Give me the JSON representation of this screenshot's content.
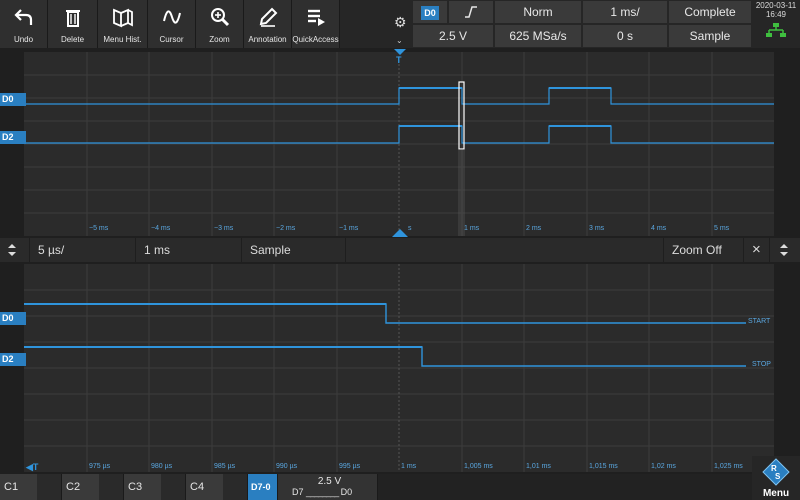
{
  "toolbar": {
    "buttons": [
      {
        "label": "Undo",
        "icon": "undo-icon"
      },
      {
        "label": "Delete",
        "icon": "trash-icon"
      },
      {
        "label": "Menu Hist.",
        "icon": "menu-history-icon"
      },
      {
        "label": "Cursor",
        "icon": "cursor-wave-icon"
      },
      {
        "label": "Zoom",
        "icon": "zoom-icon"
      },
      {
        "label": "Annotation",
        "icon": "pencil-icon"
      },
      {
        "label": "QuickAccess",
        "icon": "quick-access-icon"
      }
    ]
  },
  "settings": {
    "trigger_source": "D0",
    "trigger_edge_icon": "rising-edge-icon",
    "trigger_mode": "Norm",
    "time_scale": "1 ms/",
    "acq_status": "Complete",
    "threshold": "2.5 V",
    "sample_rate": "625 MSa/s",
    "time_offset": "0 s",
    "acq_mode": "Sample",
    "date": "2020-03-11",
    "time": "16:49"
  },
  "upper": {
    "channels": [
      "D0",
      "D2"
    ],
    "trigger_marker": "T",
    "x_ticks": [
      "−5 ms",
      "−4 ms",
      "−3 ms",
      "−2 ms",
      "−1 ms",
      "s",
      "1 ms",
      "2 ms",
      "3 ms",
      "4 ms",
      "5 ms"
    ]
  },
  "zoom_bar": {
    "scale": "5 µs/",
    "window": "1 ms",
    "mode": "Sample",
    "zoom_off": "Zoom Off",
    "close": "×"
  },
  "lower": {
    "channels": [
      "D0",
      "D2"
    ],
    "labels": [
      "START",
      "STOP"
    ],
    "x_ticks": [
      "975 µs",
      "980 µs",
      "985 µs",
      "990 µs",
      "995 µs",
      "1 ms",
      "1,005 ms",
      "1,01 ms",
      "1,015 ms",
      "1,02 ms",
      "1,025 ms"
    ]
  },
  "bottom": {
    "channels": [
      "C1",
      "C2",
      "C3",
      "C4"
    ],
    "digital_group": "D7-0",
    "digital_threshold": "2.5 V",
    "digital_hi": "D7",
    "digital_lo": "D0",
    "menu_label": "Menu"
  },
  "colors": {
    "accent": "#2a7fc1",
    "trace": "#2f94dc",
    "grid": "#3c3c3c"
  }
}
